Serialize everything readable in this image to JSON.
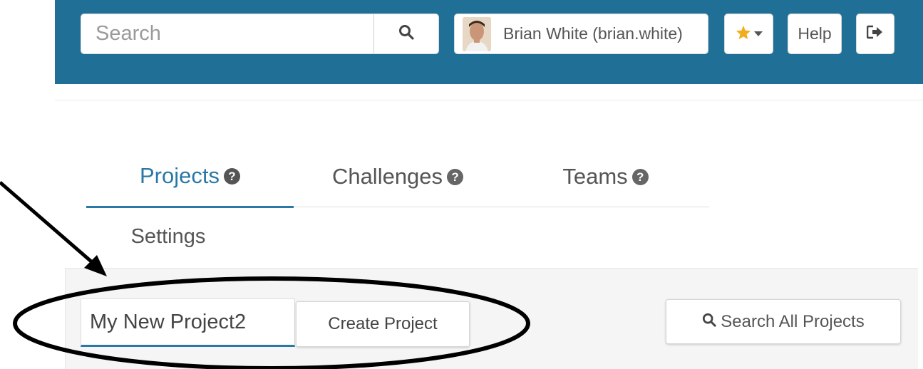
{
  "header": {
    "search": {
      "placeholder": "Search",
      "value": ""
    },
    "user": {
      "name": "Brian White (brian.white)"
    },
    "help_label": "Help",
    "icons": {
      "search": "search-icon",
      "favorites": "star-icon",
      "dropdown": "caret-down-icon",
      "logout": "sign-out-icon"
    },
    "colors": {
      "bar": "#1f6f96",
      "star": "#f0ad1e"
    }
  },
  "tabs": [
    {
      "label": "Projects",
      "active": true
    },
    {
      "label": "Challenges",
      "active": false
    },
    {
      "label": "Teams",
      "active": false
    },
    {
      "label": "Settings",
      "active": false
    }
  ],
  "create_project": {
    "input_value": "My New Project2",
    "button_label": "Create Project"
  },
  "search_all": {
    "label": "Search All Projects"
  },
  "accent_color": "#2a78a5"
}
